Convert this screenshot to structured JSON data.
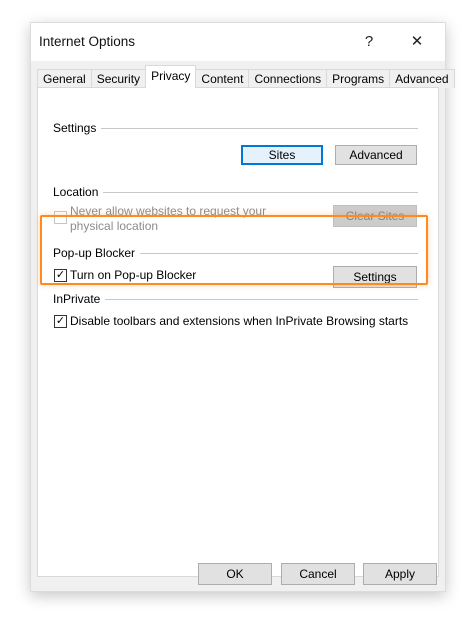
{
  "window": {
    "title": "Internet Options",
    "help_label": "?",
    "close_label": "✕"
  },
  "tabs": [
    {
      "label": "General"
    },
    {
      "label": "Security"
    },
    {
      "label": "Privacy",
      "active": true
    },
    {
      "label": "Content"
    },
    {
      "label": "Connections"
    },
    {
      "label": "Programs"
    },
    {
      "label": "Advanced"
    }
  ],
  "settings": {
    "heading": "Settings",
    "sites_label": "Sites",
    "advanced_label": "Advanced"
  },
  "location": {
    "heading": "Location",
    "never_allow_line1": "Never allow websites to request your",
    "never_allow_line2": "physical location",
    "never_allow_checked": false,
    "clear_sites_label": "Clear Sites"
  },
  "popup": {
    "heading": "Pop-up Blocker",
    "turn_on_label": "Turn on Pop-up Blocker",
    "turn_on_checked": true,
    "settings_label": "Settings"
  },
  "inprivate": {
    "heading": "InPrivate",
    "disable_label": "Disable toolbars and extensions when InPrivate Browsing starts",
    "disable_checked": true
  },
  "footer": {
    "ok_label": "OK",
    "cancel_label": "Cancel",
    "apply_label": "Apply"
  },
  "colors": {
    "highlight": "#ff8a1f",
    "focus": "#0078d7"
  },
  "check_glyph": "✓"
}
